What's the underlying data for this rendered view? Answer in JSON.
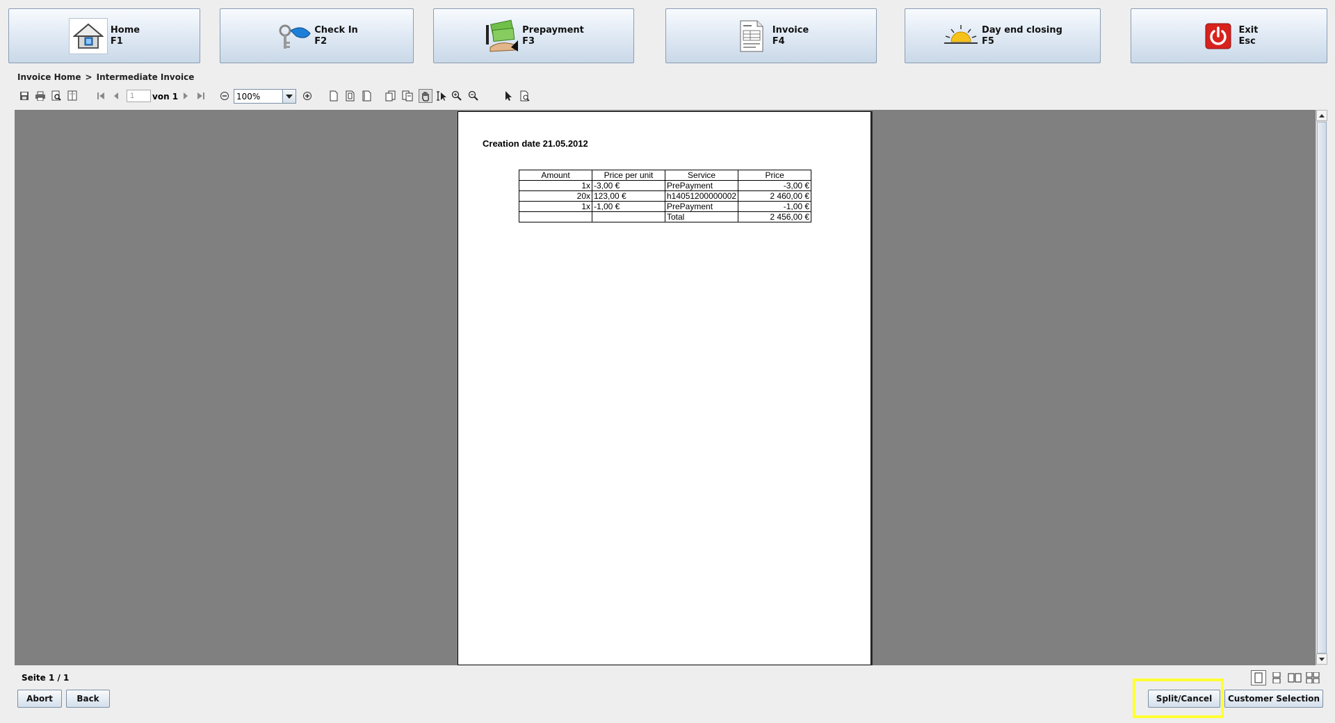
{
  "nav": [
    {
      "label": "Home",
      "key": "F1"
    },
    {
      "label": "Check In",
      "key": "F2"
    },
    {
      "label": "Prepayment",
      "key": "F3"
    },
    {
      "label": "Invoice",
      "key": "F4"
    },
    {
      "label": "Day end closing",
      "key": "F5"
    },
    {
      "label": "Exit",
      "key": "Esc"
    }
  ],
  "breadcrumb": {
    "first": "Invoice Home",
    "sep": ">",
    "current": "Intermediate Invoice"
  },
  "toolbar": {
    "page_value": "1",
    "page_of": "von 1",
    "zoom": "100%",
    "icons": [
      "save-icon",
      "print-icon",
      "print-preview-icon",
      "page-setup-icon",
      "first-page-icon",
      "previous-page-icon",
      "next-page-icon",
      "last-page-icon",
      "zoom-out-icon",
      "zoom-in-icon",
      "single-page-icon",
      "facing-pages-icon",
      "book-view-icon",
      "fit-width-icon",
      "fit-page-icon",
      "hand-tool-icon",
      "text-select-icon",
      "magnifier-zoom-in-icon",
      "magnifier-zoom-out-icon",
      "pointer-icon",
      "find-icon"
    ]
  },
  "document": {
    "creation_date": "Creation date 21.05.2012",
    "headers": [
      "Amount",
      "Price per unit",
      "Service",
      "Price"
    ],
    "rows": [
      [
        "1x",
        "-3,00 €",
        "PrePayment",
        "-3,00 €"
      ],
      [
        "20x",
        "123,00 €",
        "h14051200000002",
        "2 460,00 €"
      ],
      [
        "1x",
        "-1,00 €",
        "PrePayment",
        "-1,00 €"
      ],
      [
        "",
        "",
        "Total",
        "2 456,00 €"
      ]
    ]
  },
  "status": {
    "page": "Seite 1 / 1"
  },
  "buttons": {
    "abort": "Abort",
    "back": "Back",
    "split_cancel": "Split/Cancel",
    "customer_selection": "Customer Selection"
  },
  "colors": {
    "highlight": "#ffff33",
    "viewer_bg": "#808080",
    "nav_gradient_top": "#f8fbfe",
    "nav_gradient_bottom": "#c9d8e8"
  }
}
